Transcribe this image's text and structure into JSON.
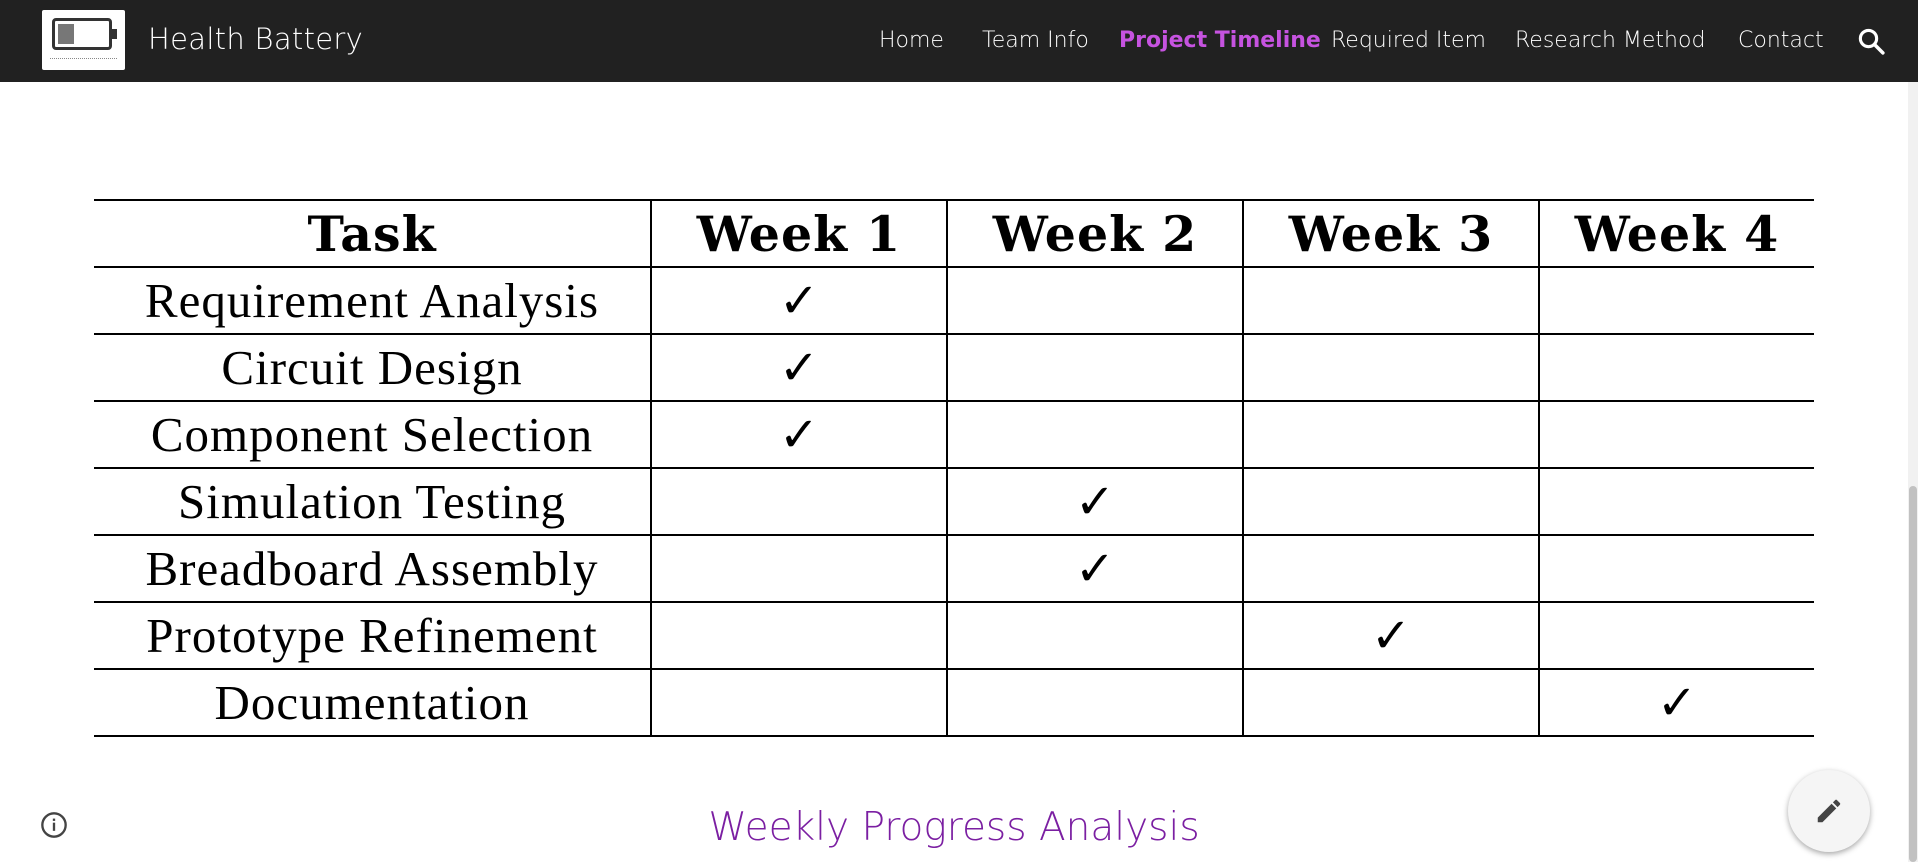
{
  "header": {
    "site_title": "Health Battery",
    "nav": [
      {
        "label": "Home",
        "active": false
      },
      {
        "label": "Team Info",
        "active": false
      },
      {
        "label": "Project Timeline",
        "active": true
      },
      {
        "label": "Required Item",
        "active": false
      },
      {
        "label": "Research Method",
        "active": false
      },
      {
        "label": "Contact",
        "active": false
      }
    ],
    "active_color": "#c653e0",
    "background": "#212121"
  },
  "table": {
    "headers": [
      "Task",
      "Week 1",
      "Week 2",
      "Week 3",
      "Week 4"
    ],
    "check_glyph": "✓",
    "rows": [
      {
        "task": "Requirement Analysis",
        "weeks": [
          true,
          false,
          false,
          false
        ]
      },
      {
        "task": "Circuit Design",
        "weeks": [
          true,
          false,
          false,
          false
        ]
      },
      {
        "task": "Component Selection",
        "weeks": [
          true,
          false,
          false,
          false
        ]
      },
      {
        "task": "Simulation Testing",
        "weeks": [
          false,
          true,
          false,
          false
        ]
      },
      {
        "task": "Breadboard Assembly",
        "weeks": [
          false,
          true,
          false,
          false
        ]
      },
      {
        "task": "Prototype Refinement",
        "weeks": [
          false,
          false,
          true,
          false
        ]
      },
      {
        "task": "Documentation",
        "weeks": [
          false,
          false,
          false,
          true
        ]
      }
    ]
  },
  "section": {
    "subheading": "Weekly Progress Analysis",
    "subheading_color": "#7b1fa2"
  },
  "icons": {
    "logo": "battery-logo-icon",
    "search": "search-icon",
    "info": "info-icon",
    "edit": "pencil-icon"
  }
}
